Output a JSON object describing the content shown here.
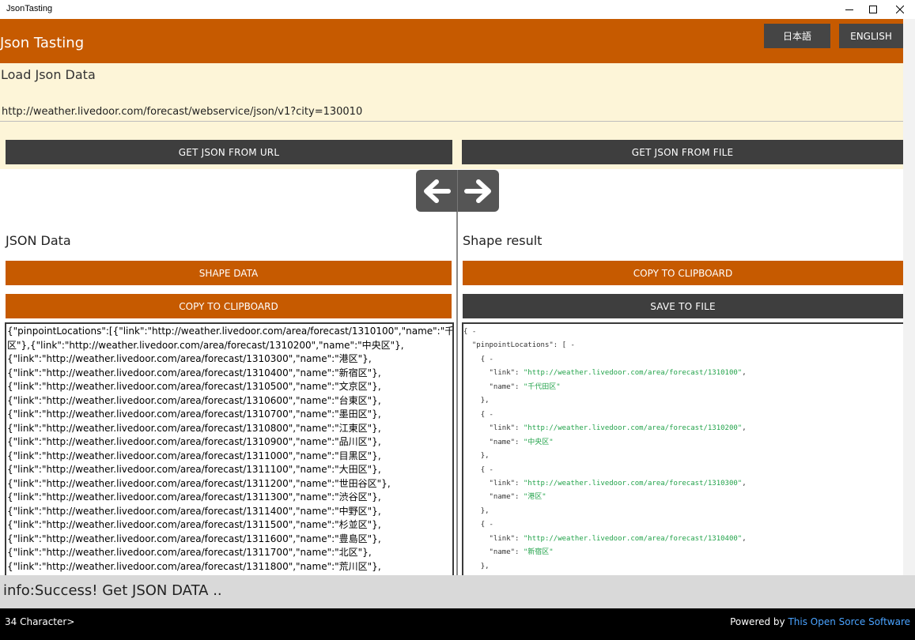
{
  "window": {
    "title": "JsonTasting",
    "controls": {
      "minimize": "minimize-icon",
      "maximize": "maximize-icon",
      "close": "close-icon"
    }
  },
  "header": {
    "app_title": "Json Tasting",
    "lang_japanese": "日本語",
    "lang_english": "ENGLISH",
    "accent_color": "#c65a00"
  },
  "load": {
    "heading": "Load Json Data",
    "url_value": "http://weather.livedoor.com/forecast/webservice/json/v1?city=130010",
    "get_from_url": "GET JSON FROM URL",
    "get_from_file": "GET JSON FROM FILE"
  },
  "arrows": {
    "left": "arrow-left-icon",
    "right": "arrow-right-icon"
  },
  "json_panel": {
    "title": "JSON Data",
    "shape_button": "SHAPE DATA",
    "copy_button": "COPY TO CLIPBOARD",
    "text": "{\"pinpointLocations\":[{\"link\":\"http://weather.livedoor.com/area/forecast/1310100\",\"name\":\"千代田\n区\"},{\"link\":\"http://weather.livedoor.com/area/forecast/1310200\",\"name\":\"中央区\"},\n{\"link\":\"http://weather.livedoor.com/area/forecast/1310300\",\"name\":\"港区\"},\n{\"link\":\"http://weather.livedoor.com/area/forecast/1310400\",\"name\":\"新宿区\"},\n{\"link\":\"http://weather.livedoor.com/area/forecast/1310500\",\"name\":\"文京区\"},\n{\"link\":\"http://weather.livedoor.com/area/forecast/1310600\",\"name\":\"台東区\"},\n{\"link\":\"http://weather.livedoor.com/area/forecast/1310700\",\"name\":\"墨田区\"},\n{\"link\":\"http://weather.livedoor.com/area/forecast/1310800\",\"name\":\"江東区\"},\n{\"link\":\"http://weather.livedoor.com/area/forecast/1310900\",\"name\":\"品川区\"},\n{\"link\":\"http://weather.livedoor.com/area/forecast/1311000\",\"name\":\"目黒区\"},\n{\"link\":\"http://weather.livedoor.com/area/forecast/1311100\",\"name\":\"大田区\"},\n{\"link\":\"http://weather.livedoor.com/area/forecast/1311200\",\"name\":\"世田谷区\"},\n{\"link\":\"http://weather.livedoor.com/area/forecast/1311300\",\"name\":\"渋谷区\"},\n{\"link\":\"http://weather.livedoor.com/area/forecast/1311400\",\"name\":\"中野区\"},\n{\"link\":\"http://weather.livedoor.com/area/forecast/1311500\",\"name\":\"杉並区\"},\n{\"link\":\"http://weather.livedoor.com/area/forecast/1311600\",\"name\":\"豊島区\"},\n{\"link\":\"http://weather.livedoor.com/area/forecast/1311700\",\"name\":\"北区\"},\n{\"link\":\"http://weather.livedoor.com/area/forecast/1311800\",\"name\":\"荒川区\"},"
  },
  "result_panel": {
    "title": "Shape result",
    "copy_button": "COPY TO CLIPBOARD",
    "save_button": "SAVE TO FILE",
    "root_open": "{ -",
    "key_pinpoint": "\"pinpointLocations\"",
    "array_open": ": [ -",
    "entries": [
      {
        "link": "\"http://weather.livedoor.com/area/forecast/1310100\"",
        "name": "\"千代田区\""
      },
      {
        "link": "\"http://weather.livedoor.com/area/forecast/1310200\"",
        "name": "\"中央区\""
      },
      {
        "link": "\"http://weather.livedoor.com/area/forecast/1310300\"",
        "name": "\"港区\""
      },
      {
        "link": "\"http://weather.livedoor.com/area/forecast/1310400\"",
        "name": "\"新宿区\""
      }
    ],
    "key_link": "\"link\"",
    "key_name": "\"name\"",
    "obj_open": "{ -",
    "obj_close": "},"
  },
  "status": {
    "message": "info:Success! Get JSON DATA .."
  },
  "footer": {
    "char_count": "34 Character>",
    "powered_prefix": "Powered by ",
    "powered_link": "This Open Sorce Software"
  }
}
